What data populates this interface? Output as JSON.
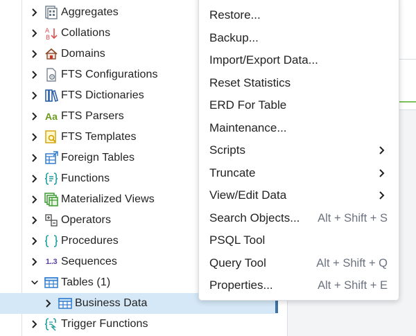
{
  "tree": {
    "items": [
      {
        "label": "Aggregates",
        "icon": "aggregates-icon"
      },
      {
        "label": "Collations",
        "icon": "collations-icon"
      },
      {
        "label": "Domains",
        "icon": "domains-icon"
      },
      {
        "label": "FTS Configurations",
        "icon": "fts-configurations-icon"
      },
      {
        "label": "FTS Dictionaries",
        "icon": "fts-dictionaries-icon"
      },
      {
        "label": "FTS Parsers",
        "icon": "fts-parsers-icon",
        "glyph": "Aa"
      },
      {
        "label": "FTS Templates",
        "icon": "fts-templates-icon"
      },
      {
        "label": "Foreign Tables",
        "icon": "foreign-tables-icon"
      },
      {
        "label": "Functions",
        "icon": "functions-icon"
      },
      {
        "label": "Materialized Views",
        "icon": "materialized-views-icon"
      },
      {
        "label": "Operators",
        "icon": "operators-icon"
      },
      {
        "label": "Procedures",
        "icon": "procedures-icon"
      },
      {
        "label": "Sequences",
        "icon": "sequences-icon",
        "glyph": "1..3"
      },
      {
        "label": "Tables (1)",
        "icon": "tables-icon",
        "expanded": true
      },
      {
        "label": "Business Data",
        "icon": "table-icon",
        "selected": true,
        "child": true
      },
      {
        "label": "Trigger Functions",
        "icon": "trigger-functions-icon"
      }
    ]
  },
  "menu": {
    "items": [
      {
        "label": "Restore...",
        "shortcut": ""
      },
      {
        "label": "Backup...",
        "shortcut": ""
      },
      {
        "label": "Import/Export Data...",
        "shortcut": ""
      },
      {
        "label": "Reset Statistics",
        "shortcut": ""
      },
      {
        "label": "ERD For Table",
        "shortcut": ""
      },
      {
        "label": "Maintenance...",
        "shortcut": ""
      },
      {
        "label": "Scripts",
        "shortcut": "",
        "submenu": true
      },
      {
        "label": "Truncate",
        "shortcut": "",
        "submenu": true
      },
      {
        "label": "View/Edit Data",
        "shortcut": "",
        "submenu": true
      },
      {
        "label": "Search Objects...",
        "shortcut": "Alt + Shift + S"
      },
      {
        "label": "PSQL Tool",
        "shortcut": ""
      },
      {
        "label": "Query Tool",
        "shortcut": "Alt + Shift + Q"
      },
      {
        "label": "Properties...",
        "shortcut": "Alt + Shift + E"
      }
    ]
  },
  "colors": {
    "selected_row": "#d5e8f7",
    "accent": "#3c72a8",
    "shortcut_text": "#6b7280"
  }
}
